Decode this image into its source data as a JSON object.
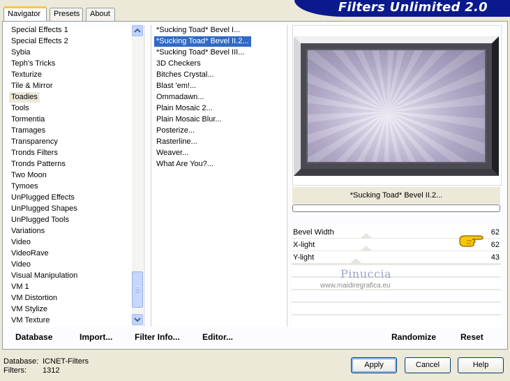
{
  "app": {
    "title": "Filters Unlimited 2.0"
  },
  "tabs": [
    {
      "label": "Navigator",
      "active": true
    },
    {
      "label": "Presets",
      "active": false
    },
    {
      "label": "About",
      "active": false
    }
  ],
  "categories": {
    "items": [
      "Special Effects 1",
      "Special Effects 2",
      "Sybia",
      "Teph's Tricks",
      "Texturize",
      "Tile & Mirror",
      "Toadies",
      "Tools",
      "Tormentia",
      "Tramages",
      "Transparency",
      "Tronds Filters",
      "Tronds Patterns",
      "Two Moon",
      "Tymoes",
      "UnPlugged Effects",
      "UnPlugged Shapes",
      "UnPlugged Tools",
      "Variations",
      "Video",
      "VideoRave",
      "Video",
      "Visual Manipulation",
      "VM 1",
      "VM Distortion",
      "VM Stylize",
      "VM Texture"
    ],
    "selected": "Toadies"
  },
  "filters": {
    "items": [
      "*Sucking Toad*  Bevel I...",
      "*Sucking Toad*  Bevel II.2...",
      "*Sucking Toad*  Bevel III...",
      "3D Checkers",
      "Bitches Crystal...",
      "Blast 'em!...",
      "Ommadawn...",
      "Plain Mosaic 2...",
      "Plain Mosaic Blur...",
      "Posterize...",
      "Rasterline...",
      "Weaver...",
      "What Are You?..."
    ],
    "selected": "*Sucking Toad*  Bevel II.2..."
  },
  "preview": {
    "filter_name": "*Sucking Toad*  Bevel II.2..."
  },
  "sliders": [
    {
      "label": "Bevel Width",
      "value": "62",
      "level": 0.243
    },
    {
      "label": "X-light",
      "value": "62",
      "level": 0.243
    },
    {
      "label": "Y-light",
      "value": "43",
      "level": 0.169
    }
  ],
  "watermark": {
    "name": "Pinuccia",
    "url": "www.maidiregrafica.eu"
  },
  "toolbar": {
    "database": "Database",
    "import": "Import...",
    "filter_info": "Filter Info...",
    "editor": "Editor...",
    "randomize": "Randomize",
    "reset": "Reset"
  },
  "footer": {
    "database_label": "Database:",
    "database_value": "ICNET-Filters",
    "filters_label": "Filters:",
    "filters_value": "1312"
  },
  "buttons": {
    "apply": "Apply",
    "cancel": "Cancel",
    "help": "Help"
  },
  "icons": {
    "hand": "pointing-hand-icon",
    "scroll_up": "chevron-up-icon",
    "scroll_down": "chevron-down-icon"
  },
  "colors": {
    "banner": "#0a1a8c",
    "selection": "#316ac5",
    "background": "#ece9d8"
  }
}
